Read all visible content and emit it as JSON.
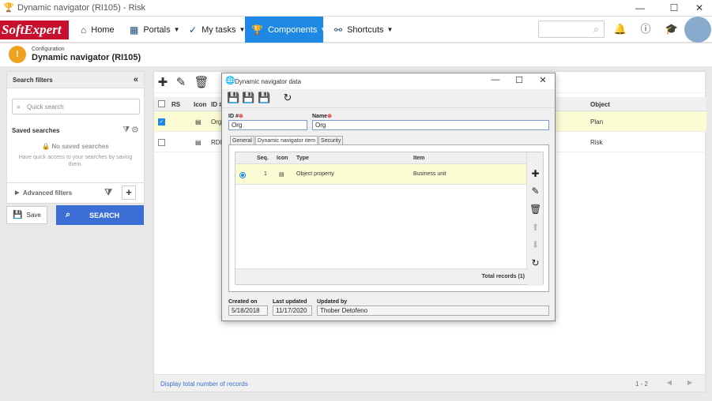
{
  "window": {
    "title": "Dynamic navigator (RI105) - Risk",
    "minimize": "—",
    "maximize": "☐",
    "close": "✕"
  },
  "logo": "SoftExpert",
  "nav": {
    "home": "Home",
    "portals": "Portals",
    "my_tasks": "My tasks",
    "components": "Components",
    "shortcuts": "Shortcuts"
  },
  "breadcrumb": {
    "section": "Configuration",
    "page_title": "Dynamic navigator (RI105)"
  },
  "filters": {
    "title": "Search filters",
    "quick_search_placeholder": "Quick search",
    "saved_searches": "Saved searches",
    "no_saved": "No saved searches",
    "help": "Have quick access to your searches by saving them.",
    "advanced": "Advanced filters",
    "save": "Save",
    "search": "SEARCH"
  },
  "grid": {
    "columns": [
      "RS",
      "Icon",
      "ID #",
      "Object"
    ],
    "rows": [
      {
        "id": "Org",
        "object": "Plan",
        "selected": true
      },
      {
        "id": "RDM",
        "object": "Risk",
        "selected": false
      }
    ],
    "footer_link": "Display total number of records",
    "pages": "1 - 2"
  },
  "dialog": {
    "title": "Dynamic navigator data",
    "id_label": "ID #",
    "id_value": "Org",
    "name_label": "Name",
    "name_value": "Org",
    "tabs": [
      "General",
      "Dynamic navigator item",
      "Security"
    ],
    "columns": [
      "Seq.",
      "Icon",
      "Type",
      "Item"
    ],
    "rows": [
      {
        "seq": "1",
        "type": "Object property",
        "item": "Business unit"
      }
    ],
    "total": "Total records (1)",
    "created_on_label": "Created on",
    "created_on": "5/18/2018",
    "updated_label": "Last updated",
    "updated": "11/17/2020",
    "updated_by_label": "Updated by",
    "updated_by": "Thober Detofeno"
  },
  "colors": {
    "accent": "#1e88e5",
    "selected_row": "#fbfbd4",
    "brand": "#c8102e"
  }
}
